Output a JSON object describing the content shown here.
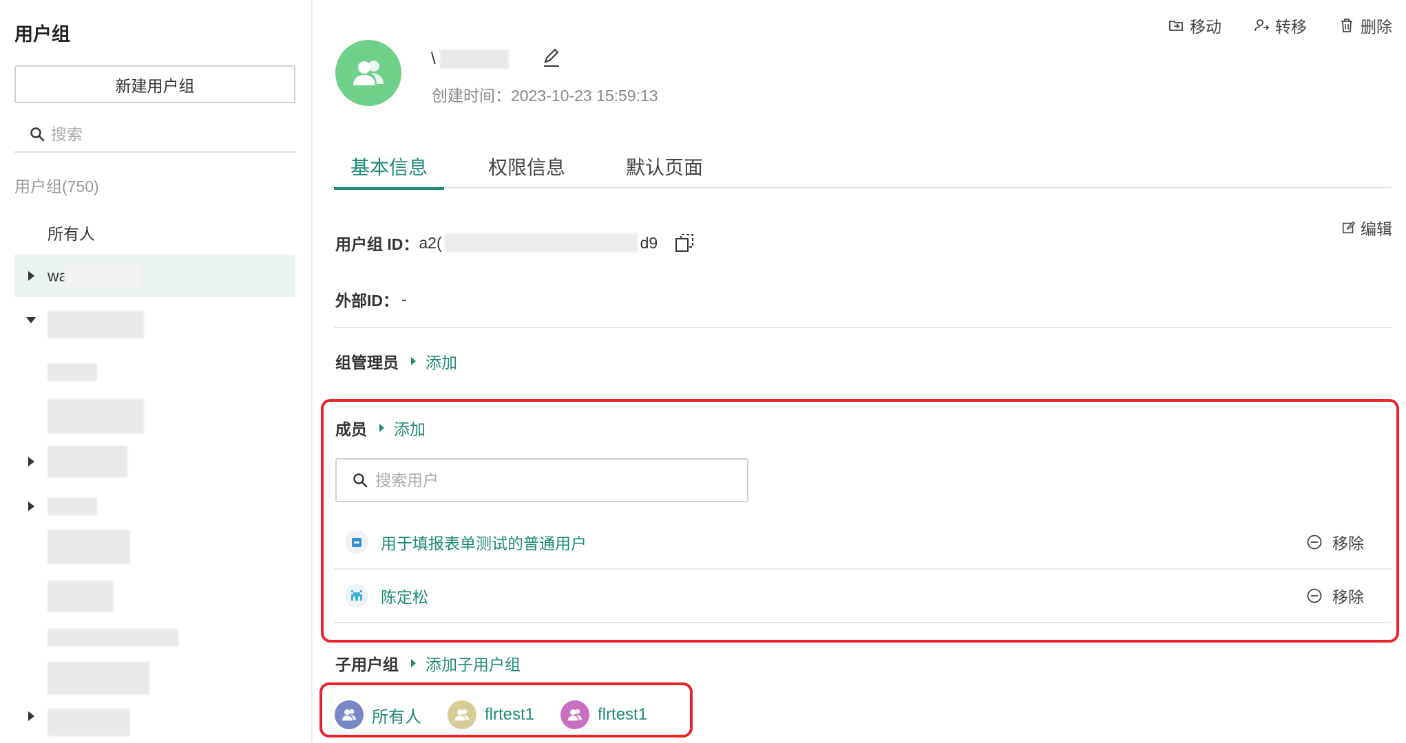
{
  "sidebar": {
    "title": "用户组",
    "new_group_button": "新建用户组",
    "search_placeholder": "搜索",
    "group_count": "用户组(750)",
    "items": [
      {
        "label": "所有人"
      },
      {
        "label": "wa"
      }
    ]
  },
  "toolbar": {
    "move": "移动",
    "transfer": "转移",
    "delete": "删除"
  },
  "group": {
    "name_prefix": "\\",
    "created_label": "创建时间：",
    "created_value": "2023-10-23 15:59:13"
  },
  "tabs": [
    {
      "label": "基本信息",
      "active": true
    },
    {
      "label": "权限信息",
      "active": false
    },
    {
      "label": "默认页面",
      "active": false
    }
  ],
  "basic_info": {
    "edit_label": "编辑",
    "group_id_label": "用户组 ID：",
    "group_id_start": "a2(",
    "group_id_end": "d9",
    "external_id_label": "外部ID：",
    "external_id_value": "-"
  },
  "admins": {
    "title": "组管理员",
    "add_label": "添加"
  },
  "members": {
    "title": "成员",
    "add_label": "添加",
    "search_placeholder": "搜索用户",
    "remove_label": "移除",
    "list": [
      {
        "name": "用于填报表单测试的普通用户",
        "icon": "robot-icon",
        "icon_color": "#2e8fd8"
      },
      {
        "name": "陈定松",
        "icon": "pixel-avatar-icon",
        "icon_color": "#3ab0d8"
      }
    ]
  },
  "subgroups": {
    "title": "子用户组",
    "add_label": "添加子用户组",
    "list": [
      {
        "name": "所有人",
        "color": "#7b86c4"
      },
      {
        "name": "flrtest1",
        "color": "#d6cc97"
      },
      {
        "name": "flrtest1",
        "color": "#c86fc1"
      }
    ]
  },
  "colors": {
    "accent": "#1e8a78",
    "group_avatar": "#6fd08a",
    "highlight_box": "#e8232a",
    "selected_bg": "#eaf3f0"
  }
}
